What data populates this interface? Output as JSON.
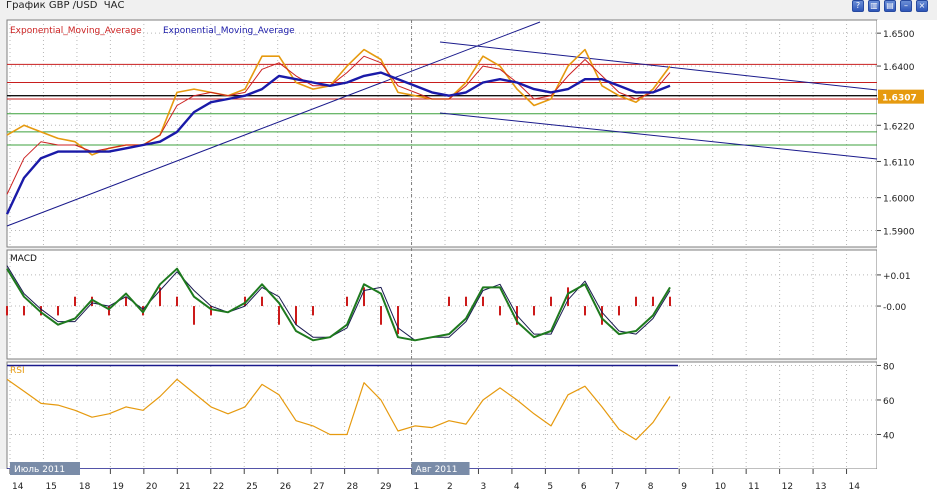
{
  "window": {
    "title": "График GBP /USD  ЧАС",
    "buttons": [
      {
        "name": "help",
        "glyph": "?"
      },
      {
        "name": "tile",
        "glyph": "▥"
      },
      {
        "name": "cascade",
        "glyph": "▤"
      },
      {
        "name": "minimize",
        "glyph": "–"
      },
      {
        "name": "close",
        "glyph": "×"
      }
    ]
  },
  "colors": {
    "price": "#e69a0f",
    "ema_fast": "#cc2222",
    "ema_slow": "#1a1aa8",
    "macd_main": "#1e7a1e",
    "macd_signal": "#1a1a50",
    "macd_hist": "#cc1a1a",
    "rsi": "#e69a0f",
    "level_red": "#c81e1e",
    "level_green": "#3ca03c",
    "trend": "#1a1a8c",
    "grid": "#b8b8b8",
    "label_bg": "#7a8ca8"
  },
  "chart_data": [
    {
      "type": "line",
      "legend": [
        {
          "name": "Exponential_Moving_Average",
          "color": "#cc2222"
        },
        {
          "name": "Exponential_Moving_Average",
          "color": "#1a1aa8"
        }
      ],
      "ylim": [
        1.585,
        1.654
      ],
      "yticks": [
        "1.6500",
        "1.6400",
        "1.6300",
        "1.6220",
        "1.6110",
        "1.6000",
        "1.5900"
      ],
      "current_price": "1.6307",
      "x_range_hours": [
        0,
        576
      ],
      "price_close": {
        "x": [
          0,
          24,
          48,
          72,
          96,
          120,
          144,
          168,
          192,
          216,
          240,
          264,
          288,
          312,
          336,
          360,
          384,
          408,
          432,
          456,
          480,
          504,
          528,
          552,
          576,
          600,
          624,
          648,
          672,
          696,
          720,
          744,
          768,
          792,
          816,
          840,
          864,
          888,
          912,
          936,
          960,
          984,
          1008,
          1032,
          1056,
          1080,
          1104,
          1128,
          1152,
          1176,
          1200,
          1224,
          1248,
          1272,
          1296,
          1320,
          1344,
          1368,
          1392
        ],
        "y": [
          1.619,
          1.622,
          1.62,
          1.618,
          1.617,
          1.613,
          1.615,
          1.616,
          1.616,
          1.619,
          1.632,
          1.633,
          1.632,
          1.631,
          1.633,
          1.643,
          1.643,
          1.635,
          1.633,
          1.634,
          1.64,
          1.645,
          1.642,
          1.632,
          1.631,
          1.63,
          1.63,
          1.635,
          1.643,
          1.64,
          1.633,
          1.628,
          1.63,
          1.64,
          1.645,
          1.634,
          1.631,
          1.629,
          1.633,
          1.64,
          1.645,
          1.636,
          1.631,
          1.63,
          1.63,
          1.63,
          1.63,
          1.63,
          1.63,
          1.63,
          1.63,
          1.63,
          1.63,
          1.63,
          1.63,
          1.63,
          1.63,
          1.63,
          1.63
        ]
      },
      "ema_fast": {
        "x": [
          0,
          24,
          48,
          72,
          96,
          120,
          144,
          168,
          192,
          216,
          240,
          264,
          288,
          312,
          336,
          360,
          384,
          408,
          432,
          456,
          480,
          504,
          528,
          552,
          576,
          600,
          624,
          648,
          672,
          696,
          720,
          744,
          768,
          792,
          816,
          840,
          864,
          888,
          912,
          936,
          960,
          984
        ],
        "y": [
          1.601,
          1.612,
          1.617,
          1.616,
          1.616,
          1.614,
          1.615,
          1.616,
          1.616,
          1.619,
          1.628,
          1.631,
          1.632,
          1.631,
          1.632,
          1.639,
          1.641,
          1.637,
          1.634,
          1.634,
          1.638,
          1.643,
          1.641,
          1.634,
          1.632,
          1.63,
          1.63,
          1.634,
          1.64,
          1.639,
          1.635,
          1.63,
          1.631,
          1.637,
          1.642,
          1.637,
          1.632,
          1.63,
          1.632,
          1.638,
          1.641,
          1.636
        ]
      },
      "ema_slow": {
        "x": [
          0,
          24,
          48,
          72,
          96,
          120,
          144,
          168,
          192,
          216,
          240,
          264,
          288,
          312,
          336,
          360,
          384,
          408,
          432,
          456,
          480,
          504,
          528,
          552,
          576,
          600,
          624,
          648,
          672,
          696,
          720,
          744,
          768,
          792,
          816,
          840,
          864,
          888,
          912,
          936,
          960,
          984
        ],
        "y": [
          1.595,
          1.606,
          1.612,
          1.614,
          1.614,
          1.614,
          1.614,
          1.615,
          1.616,
          1.617,
          1.62,
          1.626,
          1.629,
          1.63,
          1.631,
          1.633,
          1.637,
          1.636,
          1.635,
          1.634,
          1.635,
          1.637,
          1.638,
          1.636,
          1.634,
          1.632,
          1.631,
          1.632,
          1.635,
          1.636,
          1.635,
          1.633,
          1.632,
          1.633,
          1.636,
          1.636,
          1.634,
          1.632,
          1.632,
          1.634,
          1.636,
          1.635
        ]
      },
      "horizontal_levels": {
        "red": [
          1.6405,
          1.635,
          1.63
        ],
        "black": [
          1.631
        ],
        "green": [
          1.6255,
          1.62,
          1.616
        ]
      }
    },
    {
      "type": "line",
      "title": "MACD",
      "ylim": [
        -0.017,
        0.018
      ],
      "yticks": [
        "+0.01",
        "-0.00"
      ],
      "main": {
        "x": [
          0,
          24,
          48,
          72,
          96,
          120,
          144,
          168,
          192,
          216,
          240,
          264,
          288,
          312,
          336,
          360,
          384,
          408,
          432,
          456,
          480,
          504,
          528,
          552,
          576,
          600,
          624,
          648,
          672,
          696,
          720,
          744,
          768,
          792,
          816,
          840,
          864,
          888,
          912,
          936,
          960,
          984
        ],
        "y": [
          0.012,
          0.003,
          -0.002,
          -0.006,
          -0.004,
          0.002,
          -0.001,
          0.004,
          -0.002,
          0.007,
          0.012,
          0.003,
          -0.001,
          -0.002,
          0.001,
          0.007,
          0.001,
          -0.008,
          -0.011,
          -0.01,
          -0.006,
          0.007,
          0.004,
          -0.01,
          -0.011,
          -0.01,
          -0.009,
          -0.004,
          0.006,
          0.006,
          -0.005,
          -0.01,
          -0.008,
          0.004,
          0.007,
          -0.004,
          -0.009,
          -0.008,
          -0.003,
          0.006,
          0.003,
          -0.007
        ]
      },
      "signal": {
        "x": [
          0,
          24,
          48,
          72,
          96,
          120,
          144,
          168,
          192,
          216,
          240,
          264,
          288,
          312,
          336,
          360,
          384,
          408,
          432,
          456,
          480,
          504,
          528,
          552,
          576,
          600,
          624,
          648,
          672,
          696,
          720,
          744,
          768,
          792,
          816,
          840,
          864,
          888,
          912,
          936,
          960,
          984
        ],
        "y": [
          0.013,
          0.004,
          -0.001,
          -0.005,
          -0.005,
          0.001,
          0.0,
          0.003,
          -0.001,
          0.005,
          0.011,
          0.005,
          0.0,
          -0.002,
          0.0,
          0.006,
          0.003,
          -0.006,
          -0.01,
          -0.01,
          -0.007,
          0.005,
          0.006,
          -0.007,
          -0.011,
          -0.01,
          -0.01,
          -0.005,
          0.005,
          0.007,
          -0.003,
          -0.009,
          -0.009,
          0.002,
          0.008,
          -0.002,
          -0.008,
          -0.009,
          -0.004,
          0.005,
          0.005,
          -0.006
        ]
      }
    },
    {
      "type": "line",
      "title": "RSI",
      "ylim": [
        20,
        82
      ],
      "yticks": [
        "80",
        "60",
        "40"
      ],
      "levels": [
        80,
        20
      ],
      "rsi": {
        "x": [
          0,
          24,
          48,
          72,
          96,
          120,
          144,
          168,
          192,
          216,
          240,
          264,
          288,
          312,
          336,
          360,
          384,
          408,
          432,
          456,
          480,
          504,
          528,
          552,
          576,
          600,
          624,
          648,
          672,
          696,
          720,
          744,
          768,
          792,
          816,
          840,
          864,
          888,
          912,
          936,
          960,
          984
        ],
        "y": [
          72,
          65,
          58,
          57,
          54,
          50,
          52,
          56,
          54,
          62,
          72,
          64,
          56,
          52,
          56,
          69,
          63,
          48,
          45,
          40,
          40,
          70,
          60,
          42,
          45,
          44,
          48,
          46,
          60,
          67,
          60,
          52,
          45,
          63,
          68,
          56,
          43,
          37,
          47,
          62,
          65,
          44
        ]
      }
    }
  ],
  "time_axis": {
    "labels": [
      "14",
      "15",
      "18",
      "19",
      "20",
      "21",
      "22",
      "25",
      "26",
      "27",
      "28",
      "29",
      "1",
      "2",
      "3",
      "4",
      "5",
      "6",
      "7",
      "8",
      "9",
      "10",
      "11",
      "12",
      "13",
      "14"
    ],
    "month_labels": [
      {
        "text": "Июль 2011",
        "at_index": 0
      },
      {
        "text": "Авг 2011",
        "at_index": 12
      }
    ]
  }
}
